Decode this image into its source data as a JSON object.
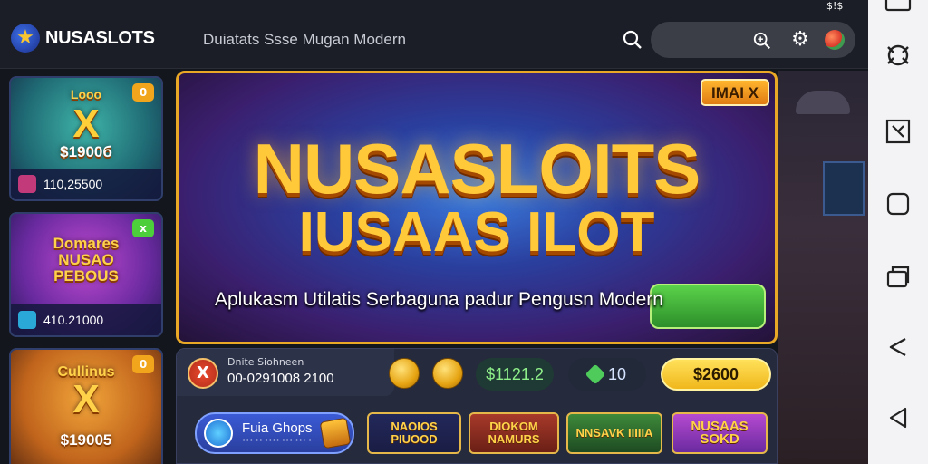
{
  "header": {
    "logo_text": "NUSASLOTS",
    "tagline": "Duiatats Ssse Mugan Modern",
    "status_text": "$!$"
  },
  "cards": [
    {
      "title": "Looo",
      "symbol": "X",
      "price": "$1900б",
      "amount": "110,25500",
      "badge": "0"
    },
    {
      "title": "Domares NUSAO PEBOUS",
      "symbol": "",
      "price": "",
      "amount": "410.21000",
      "badge": "x"
    },
    {
      "title": "Cullinus",
      "symbol": "X",
      "price": "$19005",
      "amount": "",
      "badge": "0"
    }
  ],
  "banner": {
    "title_line1": "NUSASLOITS",
    "title_line2": "IUSAAS ILOT",
    "subtitle": "Aplukasm Utilatis Serbaguna padur Pengusn Modern",
    "badge": "IMAI X"
  },
  "panel": {
    "user_name": "Dnite Siohneen",
    "user_id": "00-0291008 2100",
    "close_symbol": "X",
    "stat_cash": "$1121.2",
    "stat_gems": "10",
    "stat_gold": "$2600"
  },
  "tiles": [
    {
      "label": "Fuia Ghops",
      "sub": "••• •• •••• ••• ••• •"
    },
    {
      "label": "NAOIOS PIUOOD"
    },
    {
      "label": "DIOKOM NAMURS"
    },
    {
      "label": "NNSAVK IIIIIA"
    },
    {
      "label": "NUSAAS SOKD"
    }
  ],
  "colors": {
    "accent_gold": "#ffc93a",
    "banner_border": "#e9a826",
    "header_bg": "#1b1e26",
    "rail_bg": "#f3f3f5"
  }
}
